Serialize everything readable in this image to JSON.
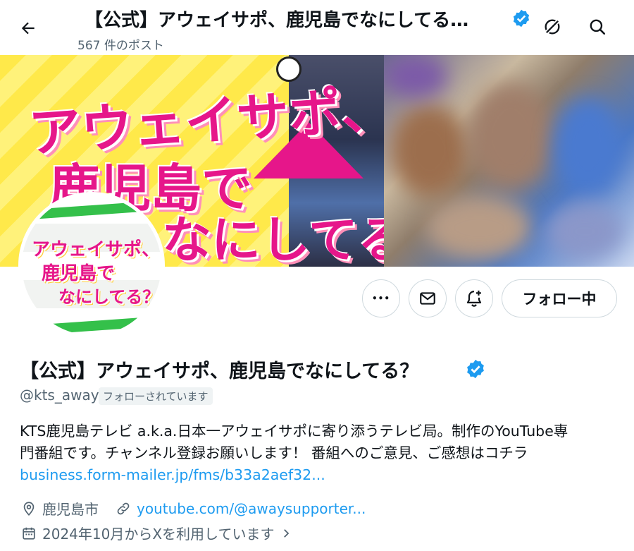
{
  "header": {
    "title": "【公式】アウェイサポ、鹿児島でなにしてる…",
    "post_count": "567 件のポスト"
  },
  "banner": {
    "line1": "アウェイサポ、",
    "line2": "鹿児島で",
    "line3": "なにしてる？"
  },
  "avatar_logo": {
    "line1": "アウェイサポ、",
    "line2": "鹿児島で",
    "line3": "なにしてる？"
  },
  "actions": {
    "more_label": "•••",
    "follow_label": "フォロー中"
  },
  "profile": {
    "display_name": "【公式】アウェイサポ、鹿児島でなにしてる？",
    "handle": "@kts_away",
    "follows_you": "フォローされています",
    "bio_line1": "KTS鹿児島テレビ a.k.a.日本一アウェイサポに寄り添うテレビ局。制作のYouTube専",
    "bio_line2": "門番組です。チャンネル登録お願いします！ 番組へのご意見、ご感想はコチラ",
    "bio_link": "business.form-mailer.jp/fms/b33a2aef32...",
    "location": "鹿児島市",
    "website": "youtube.com/@awaysupporter...",
    "joined": "2024年10月からXを利用しています"
  },
  "colors": {
    "accent": "#1d9bf0",
    "brand_pink": "#e6168a",
    "banner_yellow": "#ffe94a",
    "text_primary": "#0f1419",
    "text_secondary": "#536471"
  },
  "icons": [
    "back-arrow-icon",
    "verified-badge-icon",
    "grok-icon",
    "search-icon",
    "more-icon",
    "message-icon",
    "notification-bell-icon",
    "location-pin-icon",
    "link-icon",
    "calendar-icon",
    "chevron-right-icon"
  ]
}
